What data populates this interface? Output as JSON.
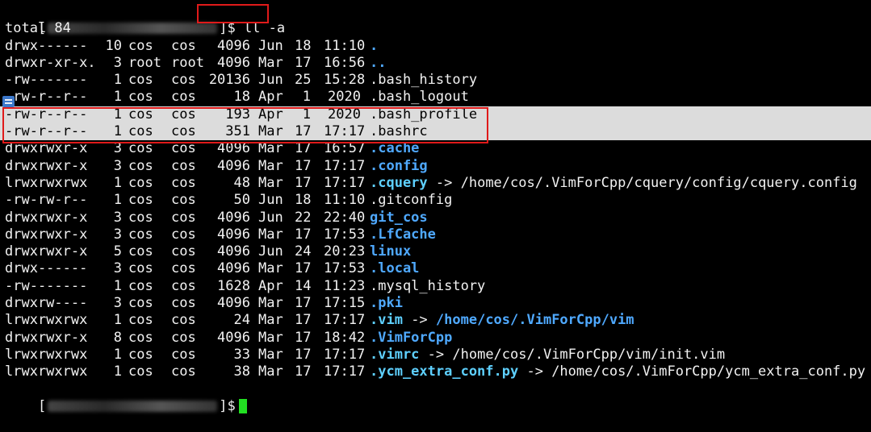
{
  "prompt": {
    "open_bracket": "[",
    "close_suffix": "]$",
    "command": "ll -a"
  },
  "total_line": "total 84",
  "entries": [
    {
      "perm": "drwx------",
      "links": "10",
      "owner": "cos",
      "group": "cos",
      "size": "4096",
      "month": "Jun",
      "day": "18",
      "time": "11:10",
      "name": ".",
      "kind": "dir",
      "target": ""
    },
    {
      "perm": "drwxr-xr-x.",
      "links": "3",
      "owner": "root",
      "group": "root",
      "size": "4096",
      "month": "Mar",
      "day": "17",
      "time": "16:56",
      "name": "..",
      "kind": "dir",
      "target": ""
    },
    {
      "perm": "-rw-------",
      "links": "1",
      "owner": "cos",
      "group": "cos",
      "size": "20136",
      "month": "Jun",
      "day": "25",
      "time": "15:28",
      "name": ".bash_history",
      "kind": "file",
      "target": ""
    },
    {
      "perm": "-rw-r--r--",
      "links": "1",
      "owner": "cos",
      "group": "cos",
      "size": "18",
      "month": "Apr",
      "day": "1",
      "time": "2020",
      "name": ".bash_logout",
      "kind": "file",
      "target": ""
    },
    {
      "perm": "-rw-r--r--",
      "links": "1",
      "owner": "cos",
      "group": "cos",
      "size": "193",
      "month": "Apr",
      "day": "1",
      "time": "2020",
      "name": ".bash_profile",
      "kind": "file",
      "target": ""
    },
    {
      "perm": "-rw-r--r--",
      "links": "1",
      "owner": "cos",
      "group": "cos",
      "size": "351",
      "month": "Mar",
      "day": "17",
      "time": "17:17",
      "name": ".bashrc",
      "kind": "file",
      "target": ""
    },
    {
      "perm": "drwxrwxr-x",
      "links": "3",
      "owner": "cos",
      "group": "cos",
      "size": "4096",
      "month": "Mar",
      "day": "17",
      "time": "16:57",
      "name": ".cache",
      "kind": "dir",
      "target": ""
    },
    {
      "perm": "drwxrwxr-x",
      "links": "3",
      "owner": "cos",
      "group": "cos",
      "size": "4096",
      "month": "Mar",
      "day": "17",
      "time": "17:17",
      "name": ".config",
      "kind": "dir",
      "target": ""
    },
    {
      "perm": "lrwxrwxrwx",
      "links": "1",
      "owner": "cos",
      "group": "cos",
      "size": "48",
      "month": "Mar",
      "day": "17",
      "time": "17:17",
      "name": ".cquery",
      "kind": "link",
      "target": "/home/cos/.VimForCpp/cquery/config/cquery.config",
      "target_kind": "file"
    },
    {
      "perm": "-rw-rw-r--",
      "links": "1",
      "owner": "cos",
      "group": "cos",
      "size": "50",
      "month": "Jun",
      "day": "18",
      "time": "11:10",
      "name": ".gitconfig",
      "kind": "file",
      "target": ""
    },
    {
      "perm": "drwxrwxr-x",
      "links": "3",
      "owner": "cos",
      "group": "cos",
      "size": "4096",
      "month": "Jun",
      "day": "22",
      "time": "22:40",
      "name": "git_cos",
      "kind": "dir",
      "target": ""
    },
    {
      "perm": "drwxrwxr-x",
      "links": "3",
      "owner": "cos",
      "group": "cos",
      "size": "4096",
      "month": "Mar",
      "day": "17",
      "time": "17:53",
      "name": ".LfCache",
      "kind": "dir",
      "target": ""
    },
    {
      "perm": "drwxrwxr-x",
      "links": "5",
      "owner": "cos",
      "group": "cos",
      "size": "4096",
      "month": "Jun",
      "day": "24",
      "time": "20:23",
      "name": "linux",
      "kind": "dir",
      "target": ""
    },
    {
      "perm": "drwx------",
      "links": "3",
      "owner": "cos",
      "group": "cos",
      "size": "4096",
      "month": "Mar",
      "day": "17",
      "time": "17:53",
      "name": ".local",
      "kind": "dir",
      "target": ""
    },
    {
      "perm": "-rw-------",
      "links": "1",
      "owner": "cos",
      "group": "cos",
      "size": "1628",
      "month": "Apr",
      "day": "14",
      "time": "11:23",
      "name": ".mysql_history",
      "kind": "file",
      "target": ""
    },
    {
      "perm": "drwxrw----",
      "links": "3",
      "owner": "cos",
      "group": "cos",
      "size": "4096",
      "month": "Mar",
      "day": "17",
      "time": "17:15",
      "name": ".pki",
      "kind": "dir",
      "target": ""
    },
    {
      "perm": "lrwxrwxrwx",
      "links": "1",
      "owner": "cos",
      "group": "cos",
      "size": "24",
      "month": "Mar",
      "day": "17",
      "time": "17:17",
      "name": ".vim",
      "kind": "link",
      "target": "/home/cos/.VimForCpp/vim",
      "target_kind": "dir"
    },
    {
      "perm": "drwxrwxr-x",
      "links": "8",
      "owner": "cos",
      "group": "cos",
      "size": "4096",
      "month": "Mar",
      "day": "17",
      "time": "18:42",
      "name": ".VimForCpp",
      "kind": "dir",
      "target": ""
    },
    {
      "perm": "lrwxrwxrwx",
      "links": "1",
      "owner": "cos",
      "group": "cos",
      "size": "33",
      "month": "Mar",
      "day": "17",
      "time": "17:17",
      "name": ".vimrc",
      "kind": "link",
      "target": "/home/cos/.VimForCpp/vim/init.vim",
      "target_kind": "file"
    },
    {
      "perm": "lrwxrwxrwx",
      "links": "1",
      "owner": "cos",
      "group": "cos",
      "size": "38",
      "month": "Mar",
      "day": "17",
      "time": "17:17",
      "name": ".ycm_extra_conf.py",
      "kind": "link",
      "target": "/home/cos/.VimForCpp/ycm_extra_conf.py",
      "target_kind": "file"
    }
  ],
  "link_arrow": "->",
  "highlighted_rows": [
    4,
    5
  ],
  "colors": {
    "background": "#000000",
    "text": "#f2f2f2",
    "directory": "#4fa9ff",
    "symlink": "#5ed0ff",
    "highlight_row": "#dcdcdc",
    "annotation_box": "#e01a1a",
    "cursor": "#22e022"
  },
  "icons": {
    "row_marker": "bookmark-marker-icon"
  }
}
